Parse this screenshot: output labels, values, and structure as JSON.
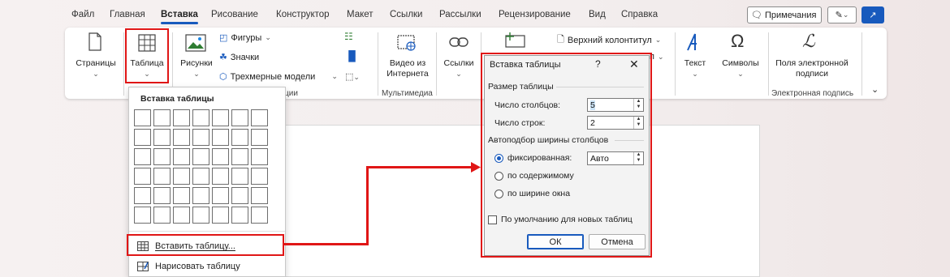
{
  "menu": {
    "tabs": [
      "Файл",
      "Главная",
      "Вставка",
      "Рисование",
      "Конструктор",
      "Макет",
      "Ссылки",
      "Рассылки",
      "Рецензирование",
      "Вид",
      "Справка"
    ],
    "active_tab": "Вставка",
    "notes_label": "Примечания"
  },
  "ribbon": {
    "pages": {
      "label": "Страницы"
    },
    "table": {
      "label": "Таблица"
    },
    "pictures": {
      "label": "Рисунки"
    },
    "shapes": "Фигуры",
    "icons": "Значки",
    "models3d": "Трехмерные модели",
    "illustrations_group_partial": "ции",
    "video": {
      "line1": "Видео из",
      "line2": "Интернета"
    },
    "media_group": "Мультимедиа",
    "links": {
      "label": "Ссылки"
    },
    "header_partial": "Верхний колонтитул",
    "partial_right": "п",
    "text": {
      "label": "Текст"
    },
    "symbols": {
      "label": "Символы"
    },
    "signature": {
      "line1": "Поля электронной",
      "line2": "подписи"
    },
    "signature_group": "Электронная подпись"
  },
  "dropdown": {
    "title": "Вставка таблицы",
    "grid_rows": 6,
    "grid_cols": 7,
    "insert_table": "Вставить таблицу...",
    "draw_table": "Нарисовать таблицу"
  },
  "dialog": {
    "title": "Вставка таблицы",
    "help": "?",
    "close": "✕",
    "size_group": "Размер таблицы",
    "cols_label": "Число столбцов:",
    "cols_value": "5",
    "rows_label": "Число строк:",
    "rows_value": "2",
    "autofit_group": "Автоподбор ширины столбцов",
    "fixed_label": "фиксированная:",
    "fixed_value": "Авто",
    "content_label": "по содержимому",
    "window_label": "по ширине окна",
    "default_label": "По умолчанию для новых таблиц",
    "ok": "ОК",
    "cancel": "Отмена"
  },
  "colors": {
    "highlight": "#e01616",
    "accent": "#185abd"
  }
}
